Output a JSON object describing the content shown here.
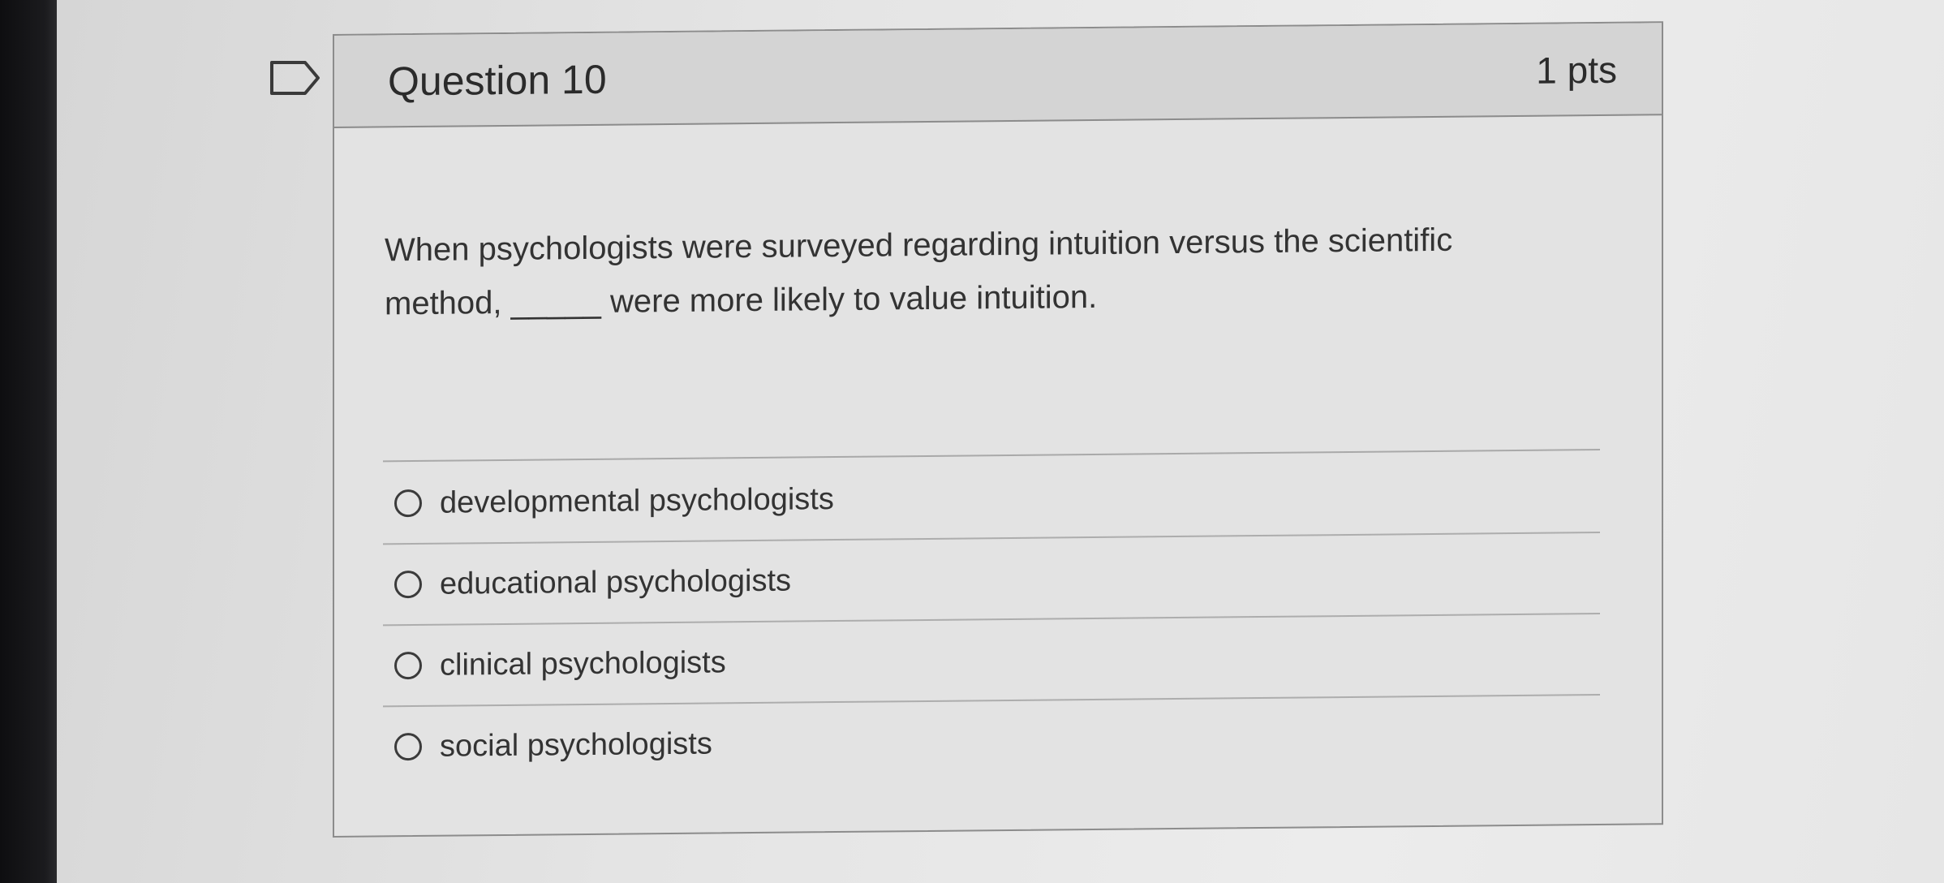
{
  "question": {
    "title": "Question 10",
    "points": "1 pts",
    "text": "When psychologists were surveyed regarding intuition versus the scientific method, _____ were more likely to value intuition."
  },
  "answers": [
    {
      "label": "developmental psychologists",
      "selected": false
    },
    {
      "label": "educational psychologists",
      "selected": false
    },
    {
      "label": "clinical psychologists",
      "selected": false
    },
    {
      "label": "social psychologists",
      "selected": false
    }
  ],
  "icons": {
    "flag": "flag-icon"
  },
  "colors": {
    "card_border": "#8c8c8c",
    "header_bg": "#d4d4d4",
    "text": "#333333"
  }
}
